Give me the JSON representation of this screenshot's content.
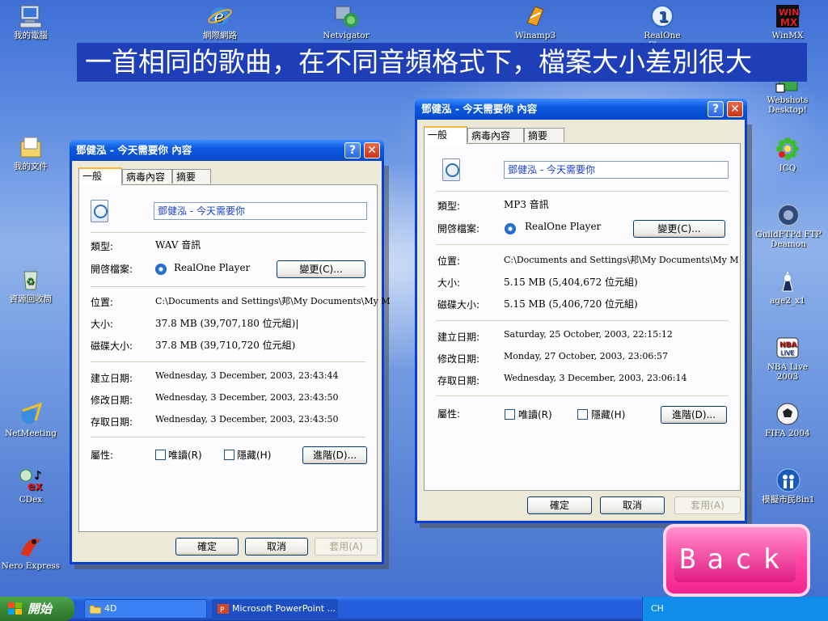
{
  "banner": "一首相同的歌曲，在不同音頻格式下，檔案大小差別很大",
  "desktop_icons": [
    {
      "label": "我的電腦",
      "icon": "my-computer-icon"
    },
    {
      "label": "網際網路",
      "icon": "internet-explorer-icon"
    },
    {
      "label": "Netvigator",
      "icon": "netvigator-icon"
    },
    {
      "label": "Winamp3",
      "icon": "winamp-icon"
    },
    {
      "label": "RealOne Player",
      "icon": "realone-player-icon"
    },
    {
      "label": "WinMX",
      "icon": "winmx-icon"
    },
    {
      "label": "Webshots Desktop!",
      "icon": "webshots-icon"
    },
    {
      "label": "我的文件",
      "icon": "my-documents-icon"
    },
    {
      "label": "ICQ",
      "icon": "icq-icon"
    },
    {
      "label": "GuildFTPd FTP Deamon",
      "icon": "guildftpd-icon"
    },
    {
      "label": "資源回收筒",
      "icon": "recycle-bin-icon"
    },
    {
      "label": "age2_x1",
      "icon": "age2-icon"
    },
    {
      "label": "NBA Live 2003",
      "icon": "nba-live-icon"
    },
    {
      "label": "NetMeeting",
      "icon": "netmeeting-icon"
    },
    {
      "label": "FIFA 2004",
      "icon": "fifa-icon"
    },
    {
      "label": "CDex",
      "icon": "cdex-icon"
    },
    {
      "label": "模擬市民8in1",
      "icon": "sims-icon"
    },
    {
      "label": "Nero Express",
      "icon": "nero-icon"
    }
  ],
  "common": {
    "tabs": [
      "一般",
      "病毒內容",
      "摘要"
    ],
    "type_label": "類型:",
    "opens_label": "開啓檔案:",
    "change_btn": "變更(C)...",
    "location_label": "位置:",
    "size_label": "大小:",
    "disk_size_label": "磁碟大小:",
    "created_label": "建立日期:",
    "modified_label": "修改日期:",
    "accessed_label": "存取日期:",
    "attributes_label": "屬性:",
    "readonly": "唯讀(R)",
    "hidden": "隱藏(H)",
    "advanced_btn": "進階(D)...",
    "ok": "確定",
    "cancel": "取消",
    "apply": "套用(A)",
    "help_glyph": "?",
    "close_glyph": "✕"
  },
  "win_wav": {
    "title": "鄧健泓 - 今天需要你 內容",
    "name": "鄧健泓 - 今天需要你",
    "type": "WAV 音訊",
    "opens_with": "RealOne Player",
    "location": "C:\\Documents and Settings\\邦\\My Documents\\My M",
    "size": "37.8 MB (39,707,180 位元組)|",
    "disk_size": "37.8 MB (39,710,720 位元組)",
    "created": "Wednesday, 3 December, 2003, 23:43:44",
    "modified": "Wednesday, 3 December, 2003, 23:43:50",
    "accessed": "Wednesday, 3 December, 2003, 23:43:50"
  },
  "win_mp3": {
    "title": "鄧健泓 - 今天需要你 內容",
    "name": "鄧健泓 - 今天需要你",
    "type": "MP3 音訊",
    "opens_with": "RealOne Player",
    "location": "C:\\Documents and Settings\\邦\\My Documents\\My M",
    "size": "5.15 MB (5,404,672 位元組)",
    "disk_size": "5.15 MB (5,406,720 位元組)",
    "created": "Saturday, 25 October, 2003, 22:15:12",
    "modified": "Monday, 27 October, 2003, 23:06:57",
    "accessed": "Wednesday, 3 December, 2003, 23:06:14"
  },
  "taskbar": {
    "start": "開始",
    "tasks": [
      "4D",
      "Microsoft PowerPoint ..."
    ],
    "tray_lang": "CH"
  },
  "back_button": "Back"
}
